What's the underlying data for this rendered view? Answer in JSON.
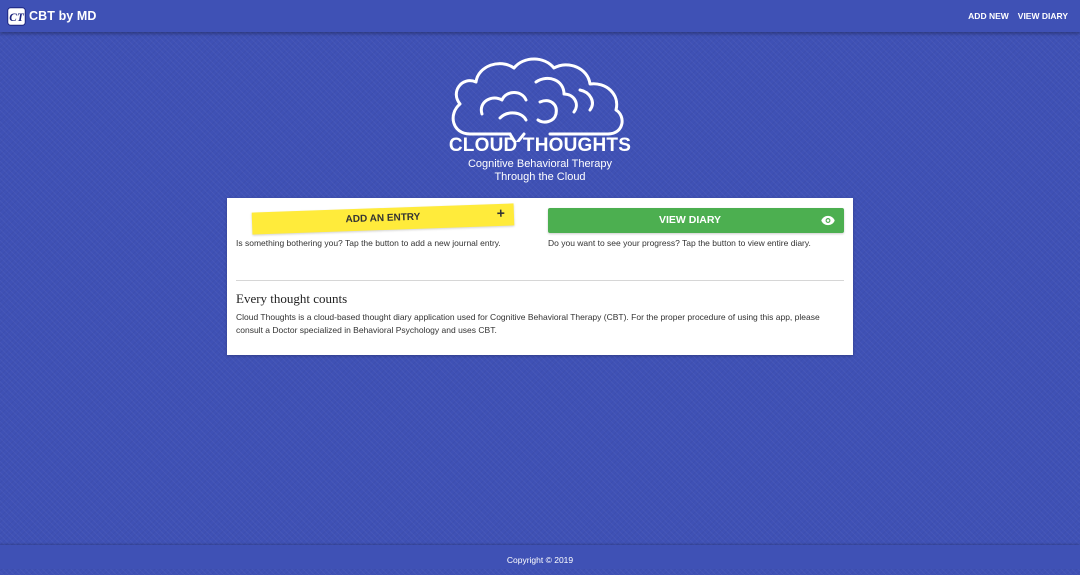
{
  "navbar": {
    "brand_logo_text": "CT",
    "brand_name": "CBT by MD",
    "links": [
      "ADD NEW",
      "VIEW DIARY"
    ]
  },
  "hero": {
    "logo_title": "CLOUD THOUGHTS",
    "subtitle_line1": "Cognitive Behavioral Therapy",
    "subtitle_line2": "Through the Cloud",
    "icon": "cloud-brain-icon"
  },
  "card": {
    "add_button_label": "ADD AN ENTRY",
    "add_button_icon": "+",
    "add_description": "Is something bothering you? Tap the button to add a new journal entry.",
    "view_button_label": "VIEW DIARY",
    "view_button_icon": "eye-icon",
    "view_description": "Do you want to see your progress? Tap the button to view entire diary.",
    "section_title": "Every thought counts",
    "section_body": "Cloud Thoughts is a cloud-based thought diary application used for Cognitive Behavioral Therapy (CBT). For the proper procedure of using this app, please consult a Doctor specialized in Behavioral Psychology and uses CBT."
  },
  "footer": {
    "copyright": "Copyright © 2019"
  },
  "colors": {
    "primary": "#3f51b5",
    "add_button": "#ffeb3b",
    "view_button": "#4caf50",
    "card": "#ffffff"
  }
}
